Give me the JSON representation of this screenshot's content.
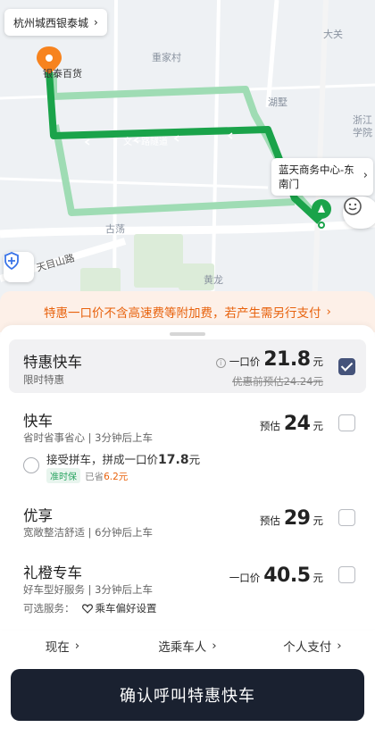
{
  "map": {
    "origin_label": "杭州城西银泰城",
    "dest_label_line1": "蓝天商务中心-东",
    "dest_label_line2": "南门",
    "places": {
      "daguan": "大关",
      "chonggu": "重家村",
      "hushu": "湖墅",
      "zhejiang_line1": "浙江",
      "zhejiang_line2": "学院",
      "yintai": "银泰百货",
      "wenyi_tunnel": "文一路隧道",
      "gudang": "古荡",
      "tianmushan": "天目山路",
      "huanglong": "黄龙"
    }
  },
  "banner": {
    "text": "特惠一口价不含高速费等附加费，若产生需另行支付"
  },
  "options": [
    {
      "title": "特惠快车",
      "subtitle": "限时特惠",
      "price_prefix": "一口价",
      "price": "21.8",
      "unit": "元",
      "original": "优惠前预估24.24元",
      "checked": true
    },
    {
      "title": "快车",
      "subtitle": "省时省事省心 | 3分钟后上车",
      "price_prefix": "预估",
      "price": "24",
      "unit": "元",
      "checked": false
    },
    {
      "title": "优享",
      "subtitle": "宽敞整洁舒适 | 6分钟后上车",
      "price_prefix": "预估",
      "price": "29",
      "unit": "元",
      "checked": false
    },
    {
      "title": "礼橙专车",
      "subtitle": "好车型好服务 | 3分钟后上车",
      "price_prefix": "一口价",
      "price": "40.5",
      "unit": "元",
      "checked": false
    }
  ],
  "carpool": {
    "text": "接受拼车，拼成一口价",
    "price": "17.8",
    "unit": "元",
    "tag": "准时保",
    "saved_prefix": "已省",
    "saved_amount": "6.2元"
  },
  "optional_services": {
    "label": "可选服务：",
    "link": "乘车偏好设置"
  },
  "footer": {
    "time": "现在",
    "passenger": "选乘车人",
    "payment": "个人支付"
  },
  "confirm_button": "确认呼叫特惠快车",
  "colors": {
    "route": "#1aa34a",
    "route_alt": "#9fdcb4",
    "banner_text": "#e8620d",
    "button": "#1a2130"
  }
}
